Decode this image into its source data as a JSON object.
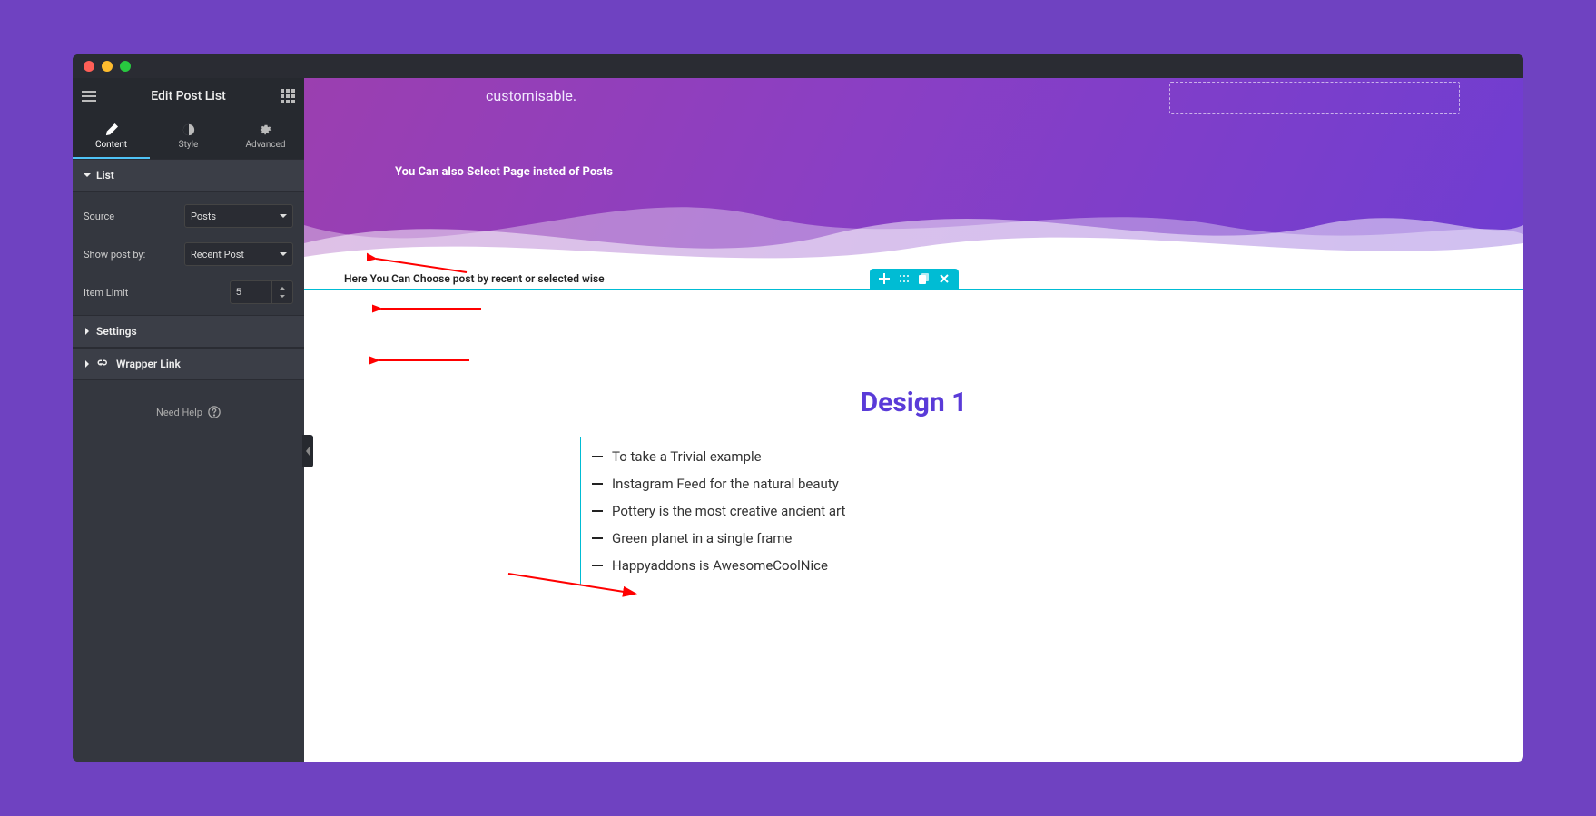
{
  "header": {
    "title": "Edit Post List"
  },
  "tabs": {
    "content": "Content",
    "style": "Style",
    "advanced": "Advanced"
  },
  "sections": {
    "list": "List",
    "settings": "Settings",
    "wrapper": "Wrapper Link"
  },
  "controls": {
    "source_label": "Source",
    "source_value": "Posts",
    "showby_label": "Show post by:",
    "showby_value": "Recent Post",
    "limit_label": "Item Limit",
    "limit_value": "5"
  },
  "help": "Need Help",
  "hero": {
    "sub": "customisable.",
    "hint": "You Can also Select Page insted of Posts",
    "hint2": "Here You Can Choose post by recent or selected wise"
  },
  "design_title": "Design 1",
  "posts": [
    "To take a Trivial example",
    "Instagram Feed for the natural beauty",
    "Pottery is the most creative ancient art",
    "Green planet in a single frame",
    "Happyaddons is AwesomeCoolNice"
  ]
}
